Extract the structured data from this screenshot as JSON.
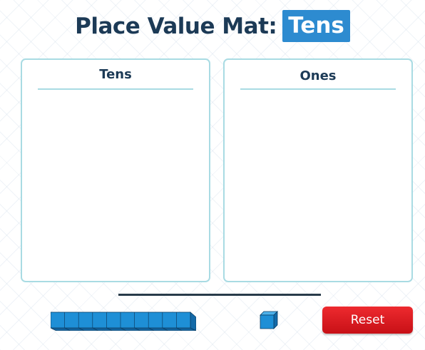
{
  "title": {
    "prefix": "Place Value Mat:",
    "highlight": "Tens"
  },
  "mat": {
    "columns": [
      {
        "label": "Tens"
      },
      {
        "label": "Ones"
      }
    ]
  },
  "manipulatives": {
    "tens_rod_icon": "tens-rod-icon",
    "ones_cube_icon": "ones-cube-icon",
    "rod_color": "#1e8fd6"
  },
  "controls": {
    "reset_label": "Reset",
    "reset_color": "#e8171d"
  },
  "colors": {
    "title": "#1c3a56",
    "badge": "#2d8bd0",
    "panel_border": "#a9dbe3"
  }
}
